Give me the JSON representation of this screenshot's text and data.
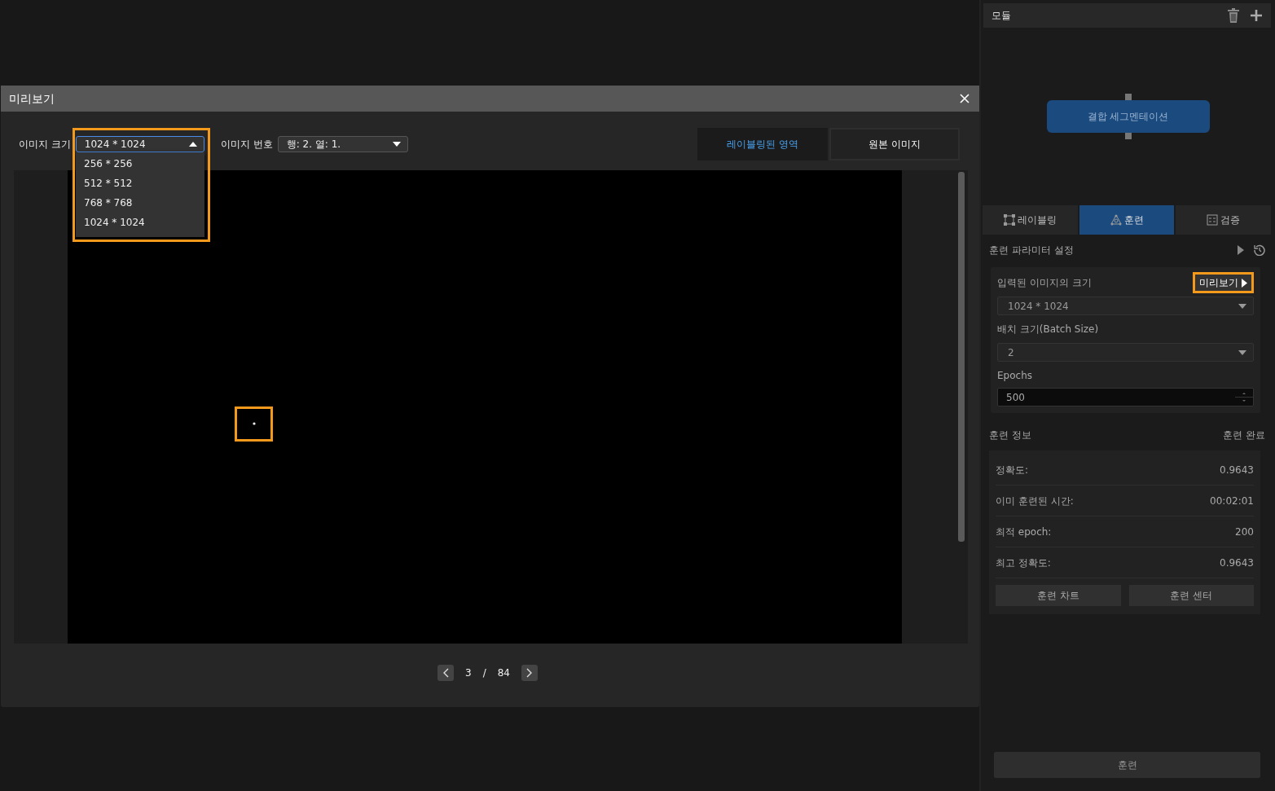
{
  "dialog": {
    "title": "미리보기",
    "image_size": {
      "label": "이미지 크기",
      "value": "1024 * 1024",
      "expanded": true,
      "options": [
        "256 * 256",
        "512 * 512",
        "768 * 768",
        "1024 * 1024"
      ]
    },
    "image_number": {
      "label": "이미지 번호",
      "value": "행: 2. 열: 1."
    },
    "view_tabs": [
      {
        "label": "레이블링된 영역",
        "selected": true
      },
      {
        "label": "원본 이미지",
        "selected": false
      }
    ],
    "pager": {
      "current": "3",
      "separator": "/",
      "total": "84"
    }
  },
  "module_panel": {
    "title": "모듈",
    "node": "결합 세그멘테이션"
  },
  "mode_tabs": [
    {
      "label": "레이블링",
      "selected": false
    },
    {
      "label": "훈련",
      "selected": true
    },
    {
      "label": "검증",
      "selected": false
    }
  ],
  "params": {
    "title": "훈련 파라미터 설정",
    "fields": [
      {
        "kind": "select",
        "label": "입력된 이미지의 크기",
        "value": "1024 * 1024",
        "action": "미리보기"
      },
      {
        "kind": "select",
        "label": "배치 크기(Batch Size)",
        "value": "2"
      },
      {
        "kind": "spin",
        "label": "Epochs",
        "value": "500"
      }
    ]
  },
  "info": {
    "title": "훈련 정보",
    "status": "훈련 완료",
    "rows": [
      {
        "label": "정확도:",
        "value": "0.9643"
      },
      {
        "label": "이미 훈련된 시간:",
        "value": "00:02:01"
      },
      {
        "label": "최적 epoch:",
        "value": "200"
      },
      {
        "label": "최고 정확도:",
        "value": "0.9643"
      }
    ],
    "buttons": [
      "훈련 차트",
      "훈련 센터"
    ]
  },
  "train_button": "훈련"
}
